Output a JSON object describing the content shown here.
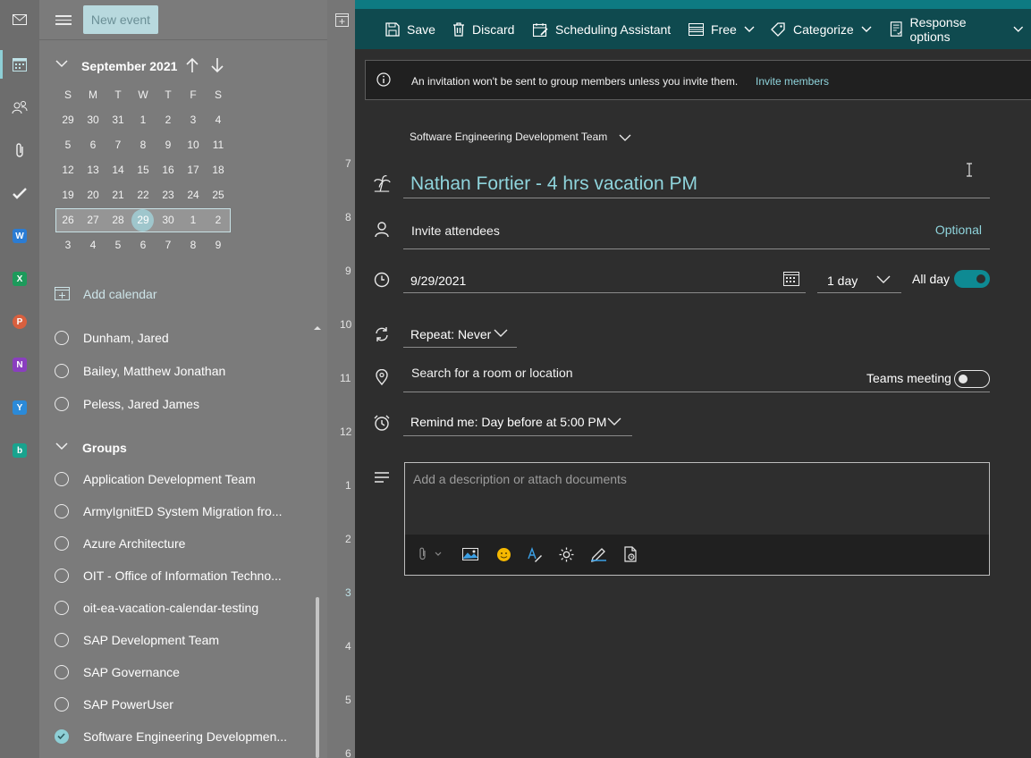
{
  "new_event": {
    "label": "New event"
  },
  "mini_calendar": {
    "month_label": "September 2021",
    "weekdays": [
      "S",
      "M",
      "T",
      "W",
      "T",
      "F",
      "S"
    ],
    "weeks": [
      [
        "29",
        "30",
        "31",
        "1",
        "2",
        "3",
        "4"
      ],
      [
        "5",
        "6",
        "7",
        "8",
        "9",
        "10",
        "11"
      ],
      [
        "12",
        "13",
        "14",
        "15",
        "16",
        "17",
        "18"
      ],
      [
        "19",
        "20",
        "21",
        "22",
        "23",
        "24",
        "25"
      ],
      [
        "26",
        "27",
        "28",
        "29",
        "30",
        "1",
        "2"
      ],
      [
        "3",
        "4",
        "5",
        "6",
        "7",
        "8",
        "9"
      ]
    ],
    "selected_week_index": 4,
    "today": "29"
  },
  "add_calendar": {
    "label": "Add calendar"
  },
  "people_calendars": [
    "Dunham, Jared",
    "Bailey, Matthew Jonathan",
    "Peless, Jared James"
  ],
  "groups": {
    "label": "Groups",
    "items": [
      {
        "label": "Application Development Team",
        "checked": false
      },
      {
        "label": "ArmyIgnitED System Migration fro...",
        "checked": false
      },
      {
        "label": "Azure Architecture",
        "checked": false
      },
      {
        "label": "OIT - Office of Information Techno...",
        "checked": false
      },
      {
        "label": "oit-ea-vacation-calendar-testing",
        "checked": false
      },
      {
        "label": "SAP Development Team",
        "checked": false
      },
      {
        "label": "SAP Governance",
        "checked": false
      },
      {
        "label": "SAP PowerUser",
        "checked": false
      },
      {
        "label": "Software Engineering Developmen...",
        "checked": true
      }
    ]
  },
  "time_strip": {
    "hours": [
      "7",
      "8",
      "9",
      "10",
      "11",
      "12",
      "1",
      "2",
      "3",
      "4",
      "5",
      "6"
    ]
  },
  "toolbar": {
    "save": "Save",
    "discard": "Discard",
    "scheduling_assistant": "Scheduling Assistant",
    "show_as": "Free",
    "categorize": "Categorize",
    "response_options": "Response options"
  },
  "info_bar": {
    "text": "An invitation won't be sent to group members unless you invite them.",
    "link": "Invite members"
  },
  "event": {
    "group": "Software Engineering Development Team",
    "title": "Nathan Fortier - 4 hrs vacation PM",
    "attendees_placeholder": "Invite attendees",
    "optional_label": "Optional",
    "date": "9/29/2021",
    "duration": "1 day",
    "all_day_label": "All day",
    "all_day": true,
    "repeat_label": "Repeat:",
    "repeat_value": "Never",
    "location_placeholder": "Search for a room or location",
    "teams_meeting_label": "Teams meeting",
    "teams_meeting": false,
    "remind_label": "Remind me:",
    "remind_value": "Day before at 5:00 PM",
    "description_placeholder": "Add a description or attach documents"
  },
  "colors": {
    "accent": "#8fd4dc",
    "toolbar_bg": "#0f4a4f",
    "toggle_on": "#0e8a93",
    "pane_bg": "#7b7b7b",
    "form_bg": "#2e2e2e"
  },
  "icons": {
    "rail": [
      "mail-icon",
      "calendar-icon",
      "people-icon",
      "files-icon",
      "todo-icon",
      "word-icon",
      "excel-icon",
      "powerpoint-icon",
      "onenote-icon",
      "yammer-icon",
      "bookings-icon"
    ],
    "description_tools": [
      "attach-icon",
      "image-icon",
      "emoji-icon",
      "format-text-icon",
      "brightness-icon",
      "draw-icon",
      "loop-icon"
    ]
  }
}
